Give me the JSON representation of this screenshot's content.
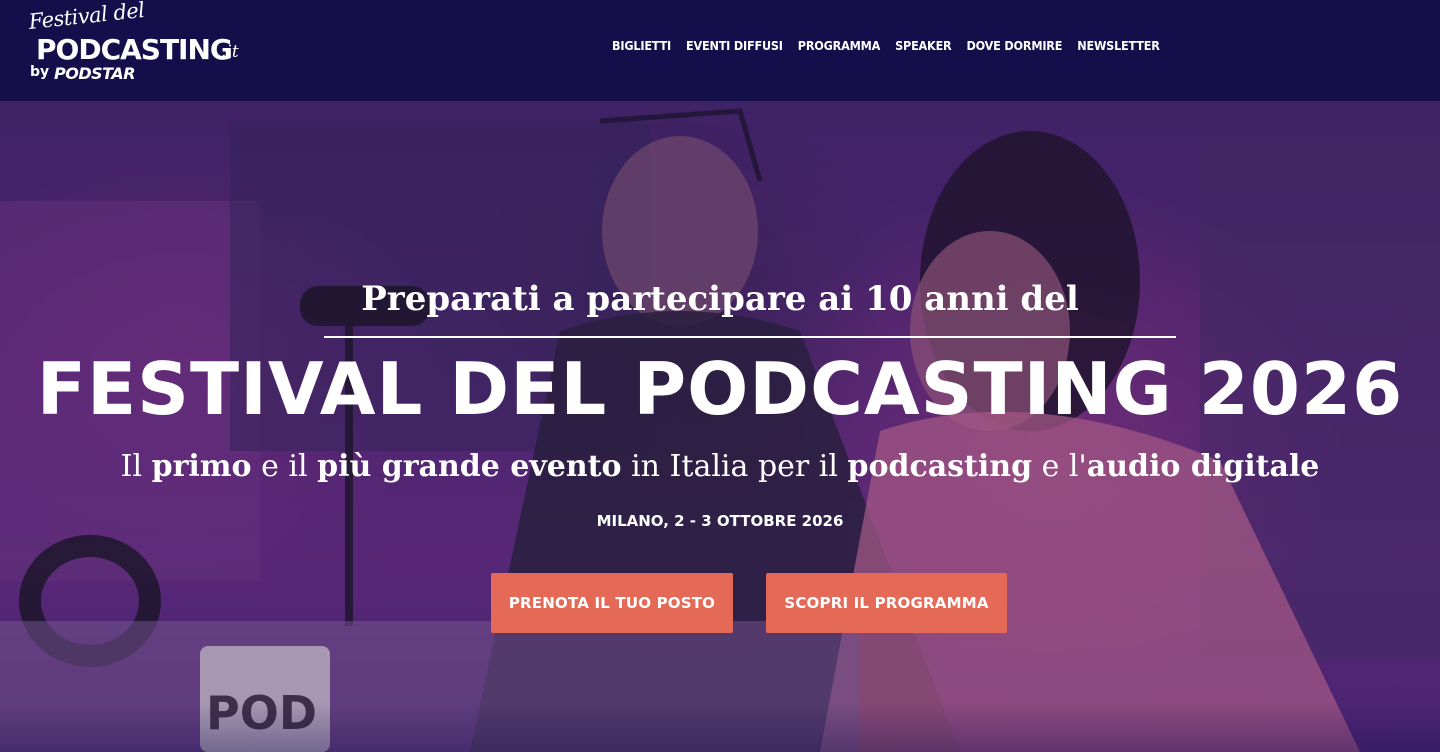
{
  "logo": {
    "script": "Festival del",
    "main": "PODCASTING",
    "tld": ".it",
    "by": "by",
    "brand": "PODSTAR"
  },
  "nav": {
    "items": [
      {
        "label": "BIGLIETTI"
      },
      {
        "label": "EVENTI DIFFUSI"
      },
      {
        "label": "PROGRAMMA"
      },
      {
        "label": "SPEAKER"
      },
      {
        "label": "DOVE DORMIRE"
      },
      {
        "label": "NEWSLETTER"
      }
    ]
  },
  "hero": {
    "pre_title_a": "Preparati a partecipare ai ",
    "pre_title_b": "10 anni del",
    "title": "FESTIVAL DEL PODCASTING 2026",
    "subtitle_parts": [
      "Il ",
      "primo",
      " e il ",
      "più grande evento",
      " in Italia per il ",
      "podcasting",
      " e l'",
      "audio digitale"
    ],
    "date": "MILANO, 2 - 3 OTTOBRE 2026",
    "cta_primary": "PRENOTA IL TUO POSTO",
    "cta_secondary": "SCOPRI IL PROGRAMMA",
    "mug_text": "POD"
  },
  "colors": {
    "header_bg": "#140f4a",
    "cta_bg": "#e46a57",
    "text": "#ffffff"
  }
}
